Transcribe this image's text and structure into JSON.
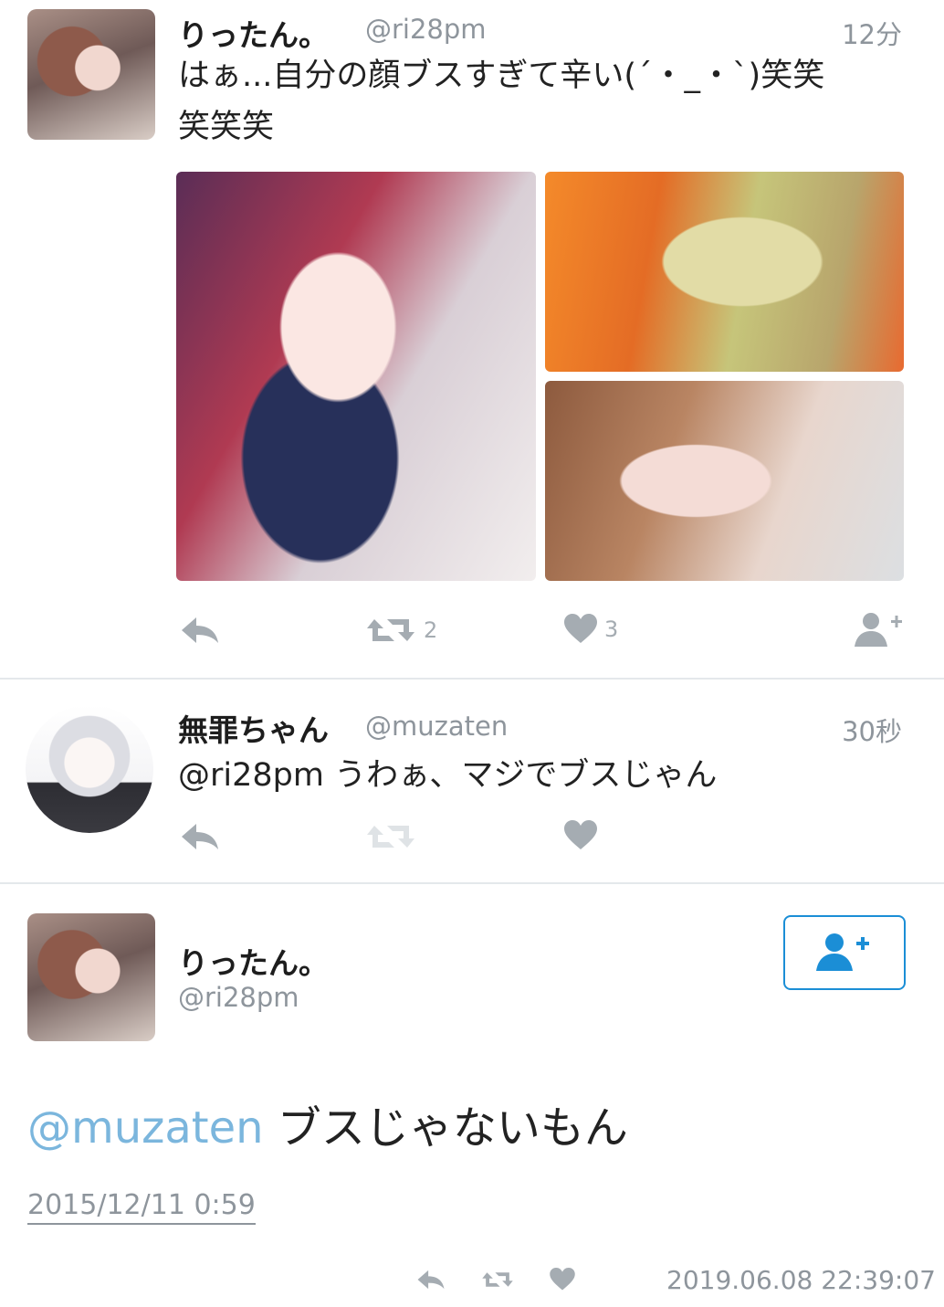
{
  "tweet1": {
    "name": "りったん。",
    "handle": "@ri28pm",
    "time": "12分",
    "text_line1": "はぁ...自分の顔ブスすぎて辛い(´・_・`)笑笑",
    "text_line2": "笑笑笑",
    "retweet_count": "2",
    "like_count": "3"
  },
  "tweet2": {
    "name": "無罪ちゃん",
    "handle": "@muzaten",
    "time": "30秒",
    "mention": "@ri28pm",
    "text": "うわぁ、マジでブスじゃん"
  },
  "tweet3": {
    "name": "りったん。",
    "handle": "@ri28pm",
    "mention": "@muzaten",
    "text": "ブスじゃないもん",
    "date": "2015/12/11 0:59"
  },
  "footer": {
    "timestamp": "2019.06.08 22:39:07"
  },
  "icons": {
    "reply": "reply-icon",
    "retweet": "retweet-icon",
    "like": "heart-icon",
    "follow": "follow-icon"
  },
  "colors": {
    "accent": "#1b8ed6",
    "link": "#7bb6dd",
    "muted": "#8e959c",
    "icon": "#a5acb2"
  }
}
